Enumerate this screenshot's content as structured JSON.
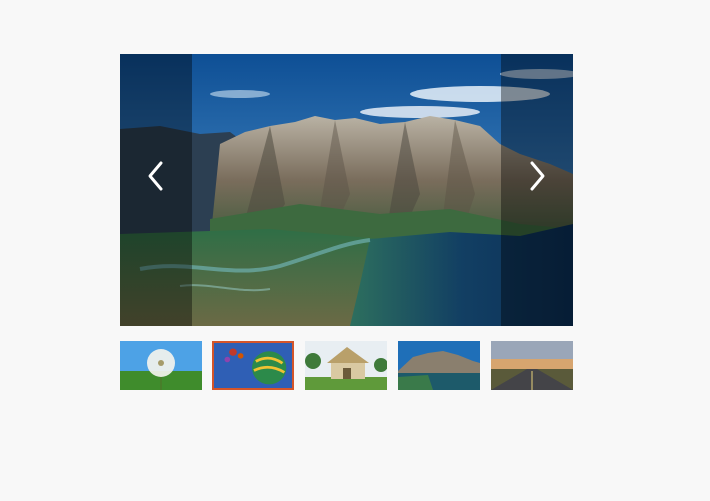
{
  "gallery": {
    "main": {
      "image_subject": "mountain-lake-landscape",
      "alt": ""
    },
    "prev_icon": "chevron-left-icon",
    "next_icon": "chevron-right-icon",
    "thumbnails": [
      {
        "subject": "dandelion"
      },
      {
        "subject": "hot-air-balloons",
        "active": true
      },
      {
        "subject": "thatched-hut"
      },
      {
        "subject": "mountain-lake"
      },
      {
        "subject": "road-at-sunset"
      }
    ],
    "accent_color": "#d4552a"
  }
}
